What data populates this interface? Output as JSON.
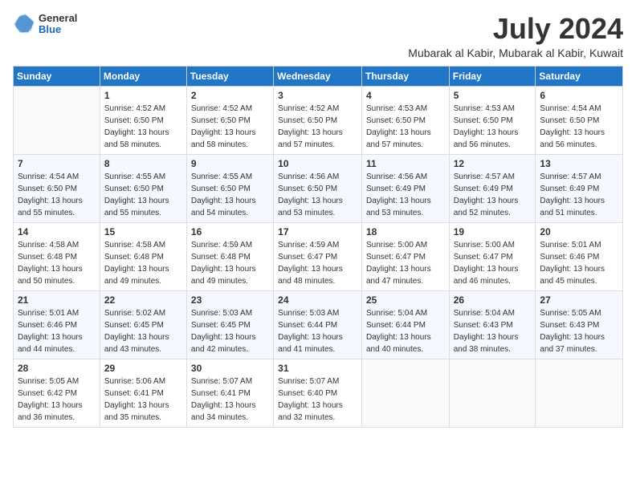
{
  "logo": {
    "general": "General",
    "blue": "Blue"
  },
  "title": "July 2024",
  "location": "Mubarak al Kabir, Mubarak al Kabir, Kuwait",
  "days_header": [
    "Sunday",
    "Monday",
    "Tuesday",
    "Wednesday",
    "Thursday",
    "Friday",
    "Saturday"
  ],
  "weeks": [
    [
      {
        "num": "",
        "info": ""
      },
      {
        "num": "1",
        "info": "Sunrise: 4:52 AM\nSunset: 6:50 PM\nDaylight: 13 hours\nand 58 minutes."
      },
      {
        "num": "2",
        "info": "Sunrise: 4:52 AM\nSunset: 6:50 PM\nDaylight: 13 hours\nand 58 minutes."
      },
      {
        "num": "3",
        "info": "Sunrise: 4:52 AM\nSunset: 6:50 PM\nDaylight: 13 hours\nand 57 minutes."
      },
      {
        "num": "4",
        "info": "Sunrise: 4:53 AM\nSunset: 6:50 PM\nDaylight: 13 hours\nand 57 minutes."
      },
      {
        "num": "5",
        "info": "Sunrise: 4:53 AM\nSunset: 6:50 PM\nDaylight: 13 hours\nand 56 minutes."
      },
      {
        "num": "6",
        "info": "Sunrise: 4:54 AM\nSunset: 6:50 PM\nDaylight: 13 hours\nand 56 minutes."
      }
    ],
    [
      {
        "num": "7",
        "info": "Sunrise: 4:54 AM\nSunset: 6:50 PM\nDaylight: 13 hours\nand 55 minutes."
      },
      {
        "num": "8",
        "info": "Sunrise: 4:55 AM\nSunset: 6:50 PM\nDaylight: 13 hours\nand 55 minutes."
      },
      {
        "num": "9",
        "info": "Sunrise: 4:55 AM\nSunset: 6:50 PM\nDaylight: 13 hours\nand 54 minutes."
      },
      {
        "num": "10",
        "info": "Sunrise: 4:56 AM\nSunset: 6:50 PM\nDaylight: 13 hours\nand 53 minutes."
      },
      {
        "num": "11",
        "info": "Sunrise: 4:56 AM\nSunset: 6:49 PM\nDaylight: 13 hours\nand 53 minutes."
      },
      {
        "num": "12",
        "info": "Sunrise: 4:57 AM\nSunset: 6:49 PM\nDaylight: 13 hours\nand 52 minutes."
      },
      {
        "num": "13",
        "info": "Sunrise: 4:57 AM\nSunset: 6:49 PM\nDaylight: 13 hours\nand 51 minutes."
      }
    ],
    [
      {
        "num": "14",
        "info": "Sunrise: 4:58 AM\nSunset: 6:48 PM\nDaylight: 13 hours\nand 50 minutes."
      },
      {
        "num": "15",
        "info": "Sunrise: 4:58 AM\nSunset: 6:48 PM\nDaylight: 13 hours\nand 49 minutes."
      },
      {
        "num": "16",
        "info": "Sunrise: 4:59 AM\nSunset: 6:48 PM\nDaylight: 13 hours\nand 49 minutes."
      },
      {
        "num": "17",
        "info": "Sunrise: 4:59 AM\nSunset: 6:47 PM\nDaylight: 13 hours\nand 48 minutes."
      },
      {
        "num": "18",
        "info": "Sunrise: 5:00 AM\nSunset: 6:47 PM\nDaylight: 13 hours\nand 47 minutes."
      },
      {
        "num": "19",
        "info": "Sunrise: 5:00 AM\nSunset: 6:47 PM\nDaylight: 13 hours\nand 46 minutes."
      },
      {
        "num": "20",
        "info": "Sunrise: 5:01 AM\nSunset: 6:46 PM\nDaylight: 13 hours\nand 45 minutes."
      }
    ],
    [
      {
        "num": "21",
        "info": "Sunrise: 5:01 AM\nSunset: 6:46 PM\nDaylight: 13 hours\nand 44 minutes."
      },
      {
        "num": "22",
        "info": "Sunrise: 5:02 AM\nSunset: 6:45 PM\nDaylight: 13 hours\nand 43 minutes."
      },
      {
        "num": "23",
        "info": "Sunrise: 5:03 AM\nSunset: 6:45 PM\nDaylight: 13 hours\nand 42 minutes."
      },
      {
        "num": "24",
        "info": "Sunrise: 5:03 AM\nSunset: 6:44 PM\nDaylight: 13 hours\nand 41 minutes."
      },
      {
        "num": "25",
        "info": "Sunrise: 5:04 AM\nSunset: 6:44 PM\nDaylight: 13 hours\nand 40 minutes."
      },
      {
        "num": "26",
        "info": "Sunrise: 5:04 AM\nSunset: 6:43 PM\nDaylight: 13 hours\nand 38 minutes."
      },
      {
        "num": "27",
        "info": "Sunrise: 5:05 AM\nSunset: 6:43 PM\nDaylight: 13 hours\nand 37 minutes."
      }
    ],
    [
      {
        "num": "28",
        "info": "Sunrise: 5:05 AM\nSunset: 6:42 PM\nDaylight: 13 hours\nand 36 minutes."
      },
      {
        "num": "29",
        "info": "Sunrise: 5:06 AM\nSunset: 6:41 PM\nDaylight: 13 hours\nand 35 minutes."
      },
      {
        "num": "30",
        "info": "Sunrise: 5:07 AM\nSunset: 6:41 PM\nDaylight: 13 hours\nand 34 minutes."
      },
      {
        "num": "31",
        "info": "Sunrise: 5:07 AM\nSunset: 6:40 PM\nDaylight: 13 hours\nand 32 minutes."
      },
      {
        "num": "",
        "info": ""
      },
      {
        "num": "",
        "info": ""
      },
      {
        "num": "",
        "info": ""
      }
    ]
  ]
}
